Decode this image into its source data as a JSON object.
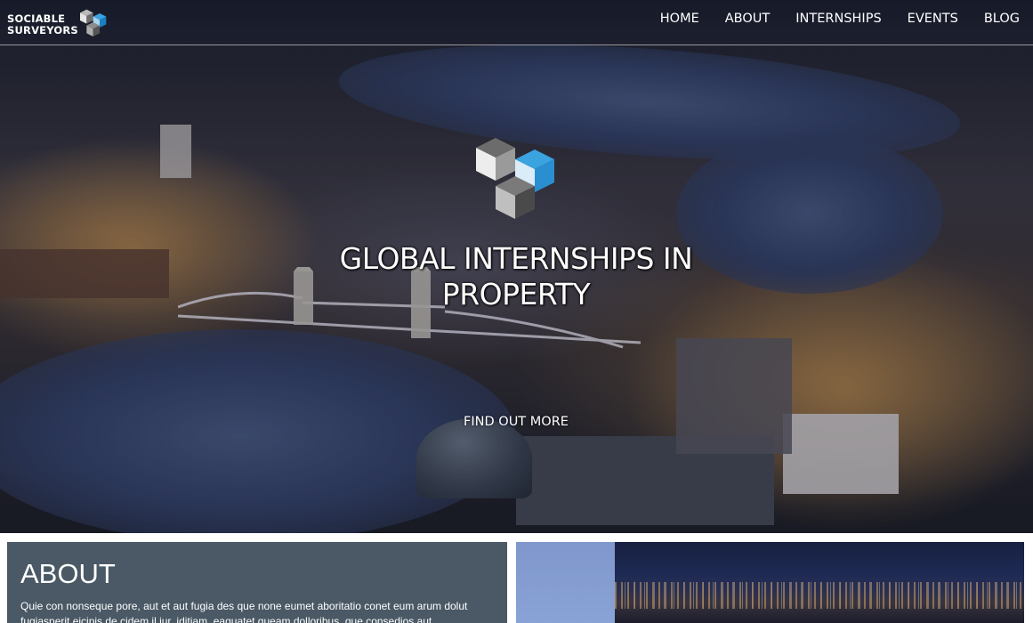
{
  "header": {
    "brand_line1": "SOCIABLE",
    "brand_line2": "SURVEYORS",
    "menu": [
      {
        "label": "HOME"
      },
      {
        "label": "ABOUT"
      },
      {
        "label": "INTERNSHIPS"
      },
      {
        "label": "EVENTS"
      },
      {
        "label": "BLOG"
      }
    ]
  },
  "hero": {
    "title_line1": "GLOBAL INTERNSHIPS IN",
    "title_line2": "PROPERTY",
    "cta_label": "FIND OUT MORE",
    "background": "aerial-night-london-photo"
  },
  "about": {
    "title": "ABOUT",
    "body": "Quie con nonseque pore, aut et aut fugia des que none eumet aboritatio conet eum arum dolut fugiasperit eicipis de cidem il iur, iditiam, eaquatet queam dolloribus, que consedios aut"
  },
  "colors": {
    "about_bg": "#4a5965",
    "logo_grey": "#8c8c8c",
    "logo_blue": "#3aa3e0",
    "text": "#ffffff"
  },
  "icons": {
    "brand": "cube-logo-icon",
    "hero": "cube-logo-icon"
  }
}
